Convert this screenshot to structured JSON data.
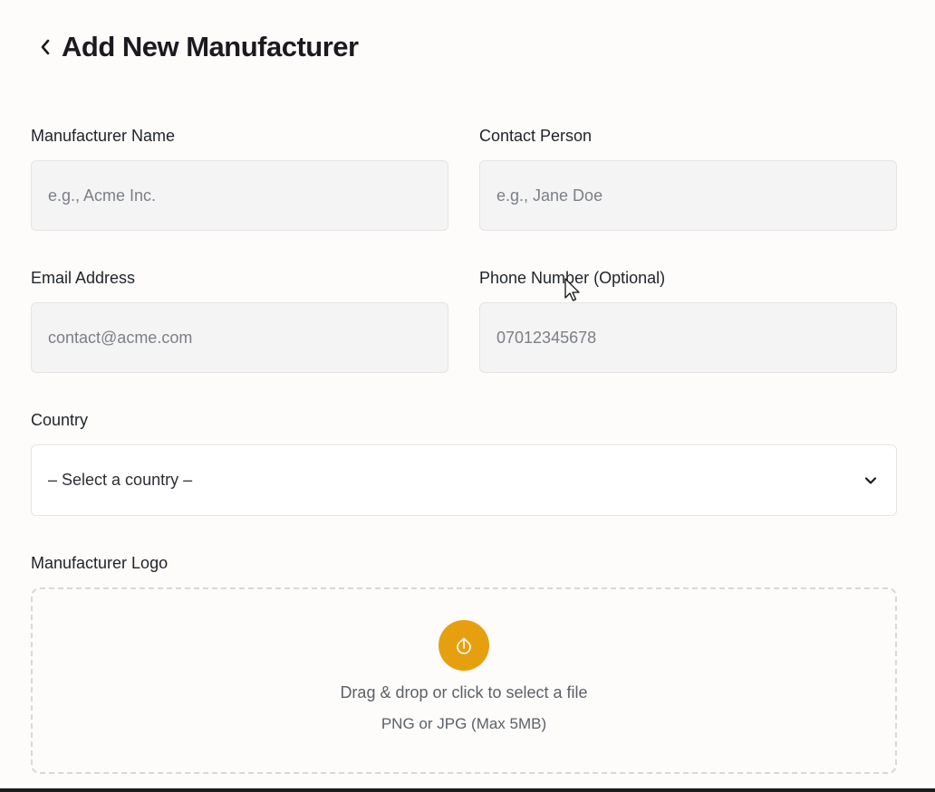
{
  "header": {
    "title": "Add New Manufacturer"
  },
  "form": {
    "manufacturer_name": {
      "label": "Manufacturer Name",
      "placeholder": "e.g., Acme Inc."
    },
    "contact_person": {
      "label": "Contact Person",
      "placeholder": "e.g., Jane Doe"
    },
    "email": {
      "label": "Email Address",
      "placeholder": "contact@acme.com"
    },
    "phone": {
      "label": "Phone Number (Optional)",
      "placeholder": "07012345678"
    },
    "country": {
      "label": "Country",
      "selected": "– Select a country –"
    },
    "logo": {
      "label": "Manufacturer Logo",
      "drop_text": "Drag & drop or click to select a file",
      "hint": "PNG or JPG (Max 5MB)"
    }
  },
  "colors": {
    "accent": "#e6a00f",
    "input_bg": "#f4f4f4",
    "border": "#e4e4e6"
  },
  "icons": {
    "back": "chevron-left-icon",
    "dropdown": "chevron-down-icon",
    "upload": "upload-icon",
    "cursor": "mouse-pointer-icon"
  }
}
